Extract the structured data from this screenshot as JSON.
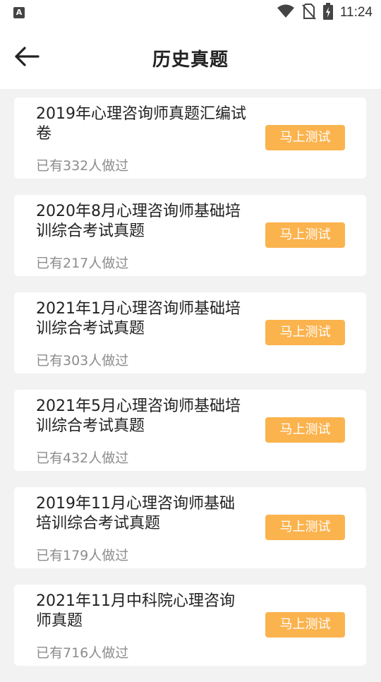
{
  "status_bar": {
    "time": "11:24",
    "left_icon_label": "A",
    "icons": [
      "wifi-icon",
      "no-sim-icon",
      "battery-charging-icon"
    ]
  },
  "header": {
    "title": "历史真题",
    "back_icon": "arrow-left-icon"
  },
  "colors": {
    "accent": "#fbb34e",
    "background": "#f2f2f2",
    "card": "#ffffff",
    "secondary_text": "#8c8c8c"
  },
  "exams": [
    {
      "title": "2019年心理咨询师真题汇编试卷",
      "count": "已有332人做过",
      "button": "马上测试"
    },
    {
      "title": "2020年8月心理咨询师基础培训综合考试真题",
      "count": "已有217人做过",
      "button": "马上测试"
    },
    {
      "title": "2021年1月心理咨询师基础培训综合考试真题",
      "count": "已有303人做过",
      "button": "马上测试"
    },
    {
      "title": "2021年5月心理咨询师基础培训综合考试真题",
      "count": "已有432人做过",
      "button": "马上测试"
    },
    {
      "title": "2019年11月心理咨询师基础培训综合考试真题",
      "count": "已有179人做过",
      "button": "马上测试"
    },
    {
      "title": "2021年11月中科院心理咨询师真题",
      "count": "已有716人做过",
      "button": "马上测试"
    }
  ]
}
